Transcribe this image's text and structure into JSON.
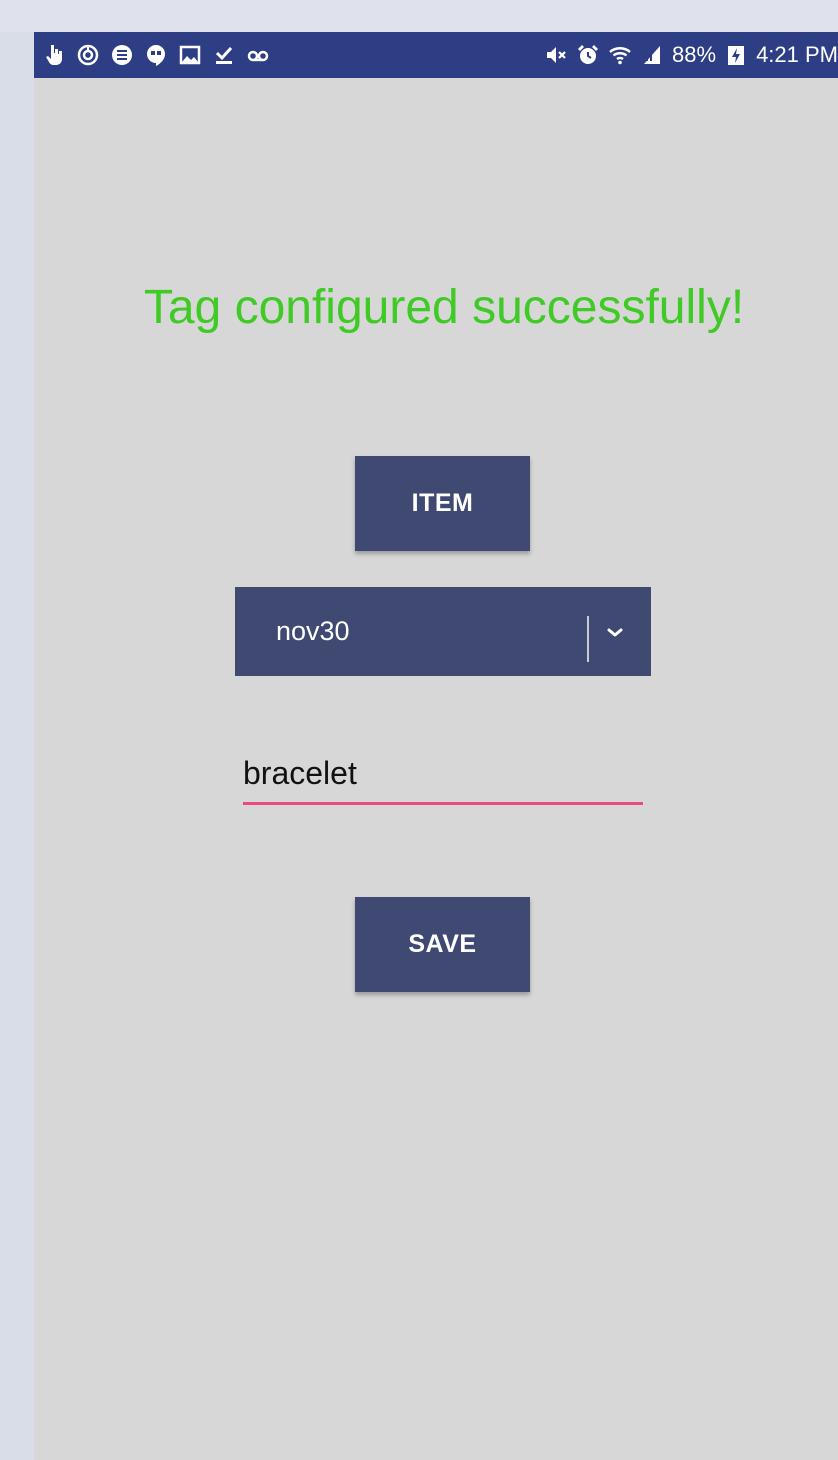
{
  "status_bar": {
    "left_icons": [
      "touch-hand-icon",
      "circle-sync-icon",
      "sim-card-icon",
      "hangouts-icon",
      "image-icon",
      "download-done-icon",
      "voicemail-icon"
    ],
    "right_icons": [
      "mute-icon",
      "alarm-icon",
      "wifi-icon",
      "signal-icon"
    ],
    "battery_percent": "88%",
    "time": "4:21 PM"
  },
  "main": {
    "success_message": "Tag configured successfully!",
    "item_button_label": "ITEM",
    "dropdown": {
      "selected": "nov30"
    },
    "name_field": {
      "value": "bracelet"
    },
    "save_button_label": "SAVE"
  },
  "colors": {
    "status_bar": "#2e3e85",
    "success_text": "#3fca25",
    "button": "#3f4972",
    "field_underline": "#ec4a7e",
    "background": "#d7d7d7"
  }
}
